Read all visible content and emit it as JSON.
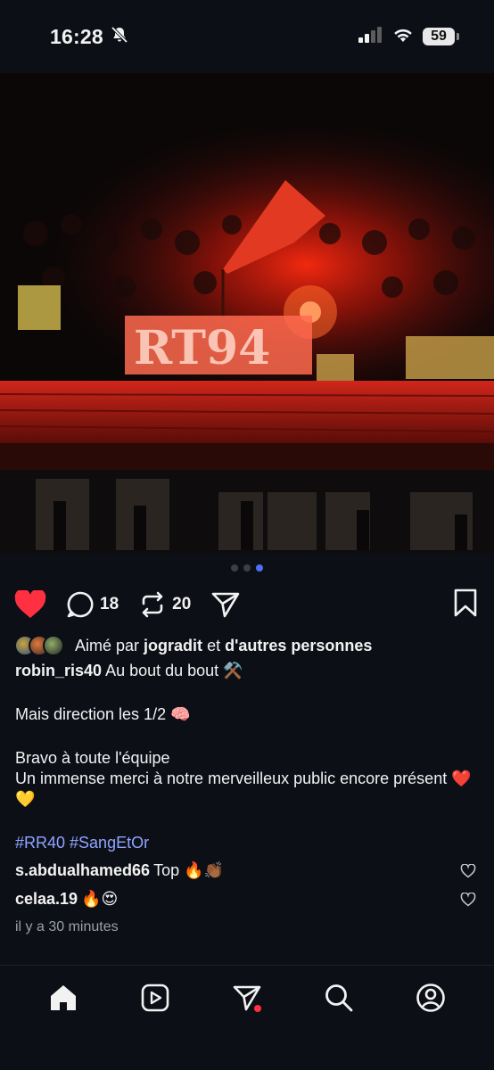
{
  "status_bar": {
    "time": "16:28",
    "battery": "59",
    "icons": [
      "bell-slash-icon",
      "signal-icon",
      "wifi-icon",
      "battery-icon"
    ]
  },
  "post": {
    "carousel": {
      "total": 3,
      "active_index": 2
    },
    "like_icon": "heart-filled-icon",
    "comment_count": "18",
    "repost_count": "20",
    "liked_by": {
      "prefix": "Aimé par",
      "user": "jogradit",
      "connector": "et",
      "others": "d'autres personnes"
    },
    "caption": {
      "author": "robin_ris40",
      "line1": "Au bout du bout ⚒️",
      "line2": "Mais direction les 1/2 🧠",
      "line3": "Bravo à toute l'équipe",
      "line4": "Un immense merci à notre merveilleux public encore présent ❤️💛",
      "hashtags": "#RR40 #SangEtOr"
    },
    "comments": [
      {
        "user": "s.abdualhamed66",
        "text": "Top 🔥👏🏾"
      },
      {
        "user": "celaa.19",
        "text": "🔥😍"
      }
    ],
    "timestamp": "il y a 30 minutes"
  },
  "bottom_nav": [
    "home-icon",
    "reels-icon",
    "messages-icon",
    "search-icon",
    "profile-icon"
  ],
  "colors": {
    "background": "#0d0f17",
    "like": "#ff3040",
    "hashtag": "#8ea4ff",
    "carousel_active": "#4f6ff5"
  }
}
